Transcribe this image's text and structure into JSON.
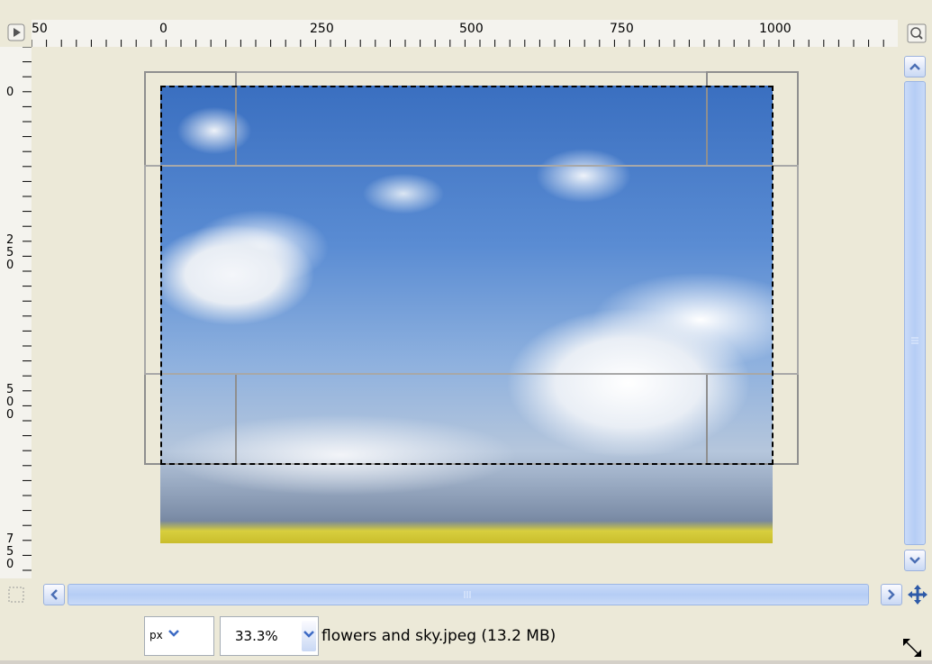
{
  "ruler": {
    "h_labels": [
      "50",
      "0",
      "250",
      "500",
      "750",
      "1000"
    ],
    "v_labels": [
      "0",
      "250",
      "500",
      "750"
    ]
  },
  "canvas": {
    "image": "flowers and sky photo",
    "selection_style": "dashed",
    "crop_handles": 4
  },
  "status": {
    "unit": "px",
    "zoom": "33.3%",
    "file_info": "flowers and sky.jpeg (13.2 MB)"
  },
  "icons": {
    "corner": "menu-arrow-icon",
    "zoom": "zoom-icon",
    "nav": "navigate-icon",
    "resize": "resize-grip-icon",
    "quickmask": "quick-mask-icon"
  }
}
